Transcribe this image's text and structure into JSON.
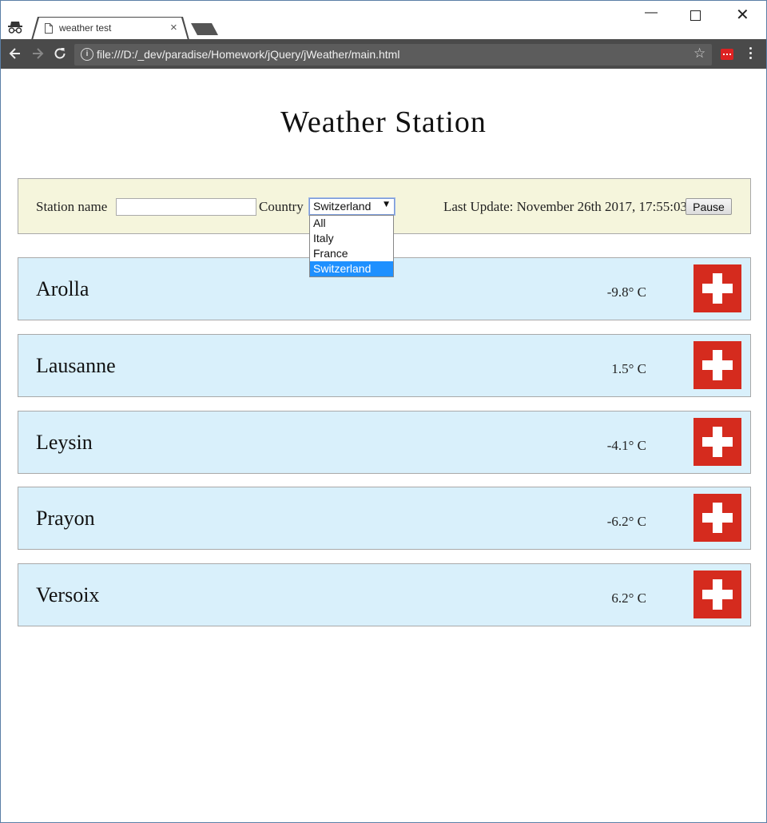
{
  "browser": {
    "tab_title": "weather test",
    "tab_close": "×",
    "url": "file:///D:/_dev/paradise/Homework/jQuery/jWeather/main.html",
    "info": "i",
    "minimize": "—",
    "close": "✕",
    "star": "☆"
  },
  "page": {
    "title": "Weather Station"
  },
  "filter": {
    "station_label": "Station name",
    "station_value": "",
    "country_label": "Country",
    "country_selected": "Switzerland",
    "country_arrow": "▼",
    "country_options": [
      "All",
      "Italy",
      "France",
      "Switzerland"
    ],
    "last_update": "Last Update: November 26th 2017, 17:55:03",
    "pause_label": "Pause"
  },
  "stations": [
    {
      "name": "Arolla",
      "temp": "-9.8° C",
      "flag": "swiss-flag-icon"
    },
    {
      "name": "Lausanne",
      "temp": "1.5° C",
      "flag": "swiss-flag-icon"
    },
    {
      "name": "Leysin",
      "temp": "-4.1° C",
      "flag": "swiss-flag-icon"
    },
    {
      "name": "Prayon",
      "temp": "-6.2° C",
      "flag": "swiss-flag-icon"
    },
    {
      "name": "Versoix",
      "temp": "6.2° C",
      "flag": "swiss-flag-icon"
    }
  ],
  "colors": {
    "filter_bg": "#f5f5dc",
    "station_bg": "#d9f0fb",
    "flag_red": "#d52b1e",
    "selected_option": "#1e90ff"
  }
}
